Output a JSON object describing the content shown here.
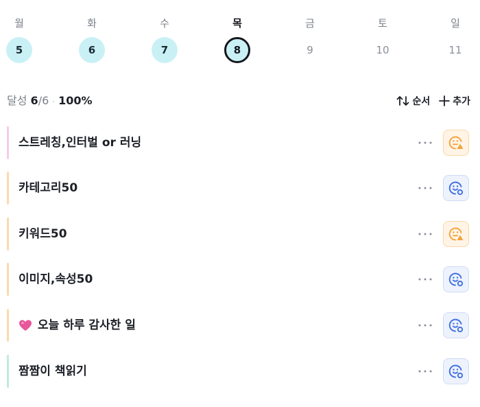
{
  "week": {
    "days": [
      {
        "label": "월",
        "date": "5",
        "state": "done"
      },
      {
        "label": "화",
        "date": "6",
        "state": "done"
      },
      {
        "label": "수",
        "date": "7",
        "state": "done"
      },
      {
        "label": "목",
        "date": "8",
        "state": "today"
      },
      {
        "label": "금",
        "date": "9",
        "state": "future"
      },
      {
        "label": "토",
        "date": "10",
        "state": "future"
      },
      {
        "label": "일",
        "date": "11",
        "state": "future"
      }
    ]
  },
  "summary": {
    "label": "달성",
    "done": "6",
    "total": "/6",
    "separator": "·",
    "percent": "100%"
  },
  "actions": {
    "sort_label": "순서",
    "add_label": "추가"
  },
  "habits": [
    {
      "name": "스트레칭,인터벌 or 러닝",
      "bar_color": "#f6cde3",
      "status": "warn",
      "status_icon": "face-warning-icon",
      "emoji": ""
    },
    {
      "name": "카테고리50",
      "bar_color": "#fbd9ad",
      "status": "ok",
      "status_icon": "face-ok-icon",
      "emoji": ""
    },
    {
      "name": "키워드50",
      "bar_color": "#fbd9ad",
      "status": "warn",
      "status_icon": "face-warning-icon",
      "emoji": ""
    },
    {
      "name": "이미지,속성50",
      "bar_color": "#fbd9ad",
      "status": "ok",
      "status_icon": "face-ok-icon",
      "emoji": ""
    },
    {
      "name": "오늘 하루 감사한 일",
      "bar_color": "#fbd9ad",
      "status": "ok",
      "status_icon": "face-ok-icon",
      "emoji": "heart-icon"
    },
    {
      "name": "짬짬이 책읽기",
      "bar_color": "#bdecd9",
      "status": "ok",
      "status_icon": "face-ok-icon",
      "emoji": ""
    }
  ],
  "colors": {
    "done_fill": "#c9f1f5",
    "warn_icon": "#f5a33c",
    "ok_icon": "#3f6fe0",
    "heart": "#e8579a"
  }
}
